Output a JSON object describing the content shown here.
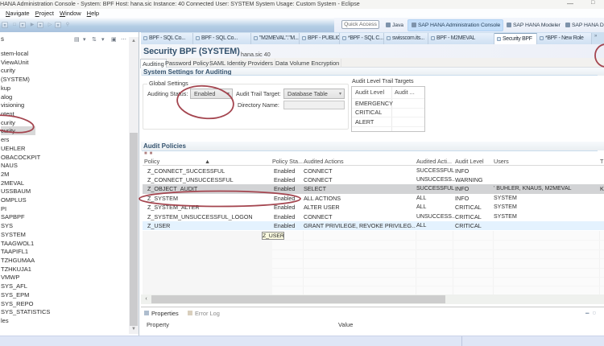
{
  "window": {
    "title": "HANA Administration Console - System: BPF Host: hana.sic Instance: 40 Connected User: SYSTEM System Usage: Custom System - Eclipse",
    "menus": [
      "Navigate",
      "Project",
      "Window",
      "Help"
    ],
    "quick_access_label": "Quick Access",
    "perspectives": [
      {
        "label": "Java"
      },
      {
        "label": "SAP HANA Administration Console",
        "active": true
      },
      {
        "label": "SAP HANA Modeler"
      },
      {
        "label": "SAP HANA Devel"
      }
    ]
  },
  "editor_tabs": [
    {
      "label": "BPF - SQL Co..."
    },
    {
      "label": "BPF - SQL Co..."
    },
    {
      "label": "\"M2MEVAL\".\"M..."
    },
    {
      "label": "BPF - PUBLIC..."
    },
    {
      "label": "*BPF - SQL C..."
    },
    {
      "label": "swisscom.its..."
    },
    {
      "label": "BPF - M2MEVAL"
    },
    {
      "label": "Security BPF",
      "active": true
    },
    {
      "label": "*BPF - New Role"
    }
  ],
  "sidebar": {
    "panel_label": "s",
    "items": [
      {
        "label": "stem-local"
      },
      {
        "label": "ViewAUnit"
      },
      {
        "label": "curity"
      },
      {
        "label": "(SYSTEM)"
      },
      {
        "label": "kup"
      },
      {
        "label": "alog"
      },
      {
        "label": "visioning"
      },
      {
        "label": "ntent"
      },
      {
        "label": "curity"
      },
      {
        "label": "curity",
        "selected": true
      },
      {
        "label": "ers"
      },
      {
        "label": "UEHLER"
      },
      {
        "label": "OBACOCKPIT"
      },
      {
        "label": "NAUS"
      },
      {
        "label": "2M"
      },
      {
        "label": "2MEVAL"
      },
      {
        "label": "USSBAUM"
      },
      {
        "label": "OMPLUS"
      },
      {
        "label": "PI"
      },
      {
        "label": "SAPBPF"
      },
      {
        "label": "SYS"
      },
      {
        "label": "SYSTEM"
      },
      {
        "label": "TAAGWOL1"
      },
      {
        "label": "TAAPIFL1"
      },
      {
        "label": "TZHGUMAA"
      },
      {
        "label": "TZHKUJA1"
      },
      {
        "label": "VMWP"
      },
      {
        "label": "SYS_AFL"
      },
      {
        "label": "SYS_EPM"
      },
      {
        "label": "SYS_REPO"
      },
      {
        "label": "SYS_STATISTICS"
      },
      {
        "label": "les"
      }
    ]
  },
  "editor": {
    "title": "Security BPF (SYSTEM)",
    "subtitle": "hana.sic 40",
    "tabs": [
      {
        "label": "Auditing",
        "active": true
      },
      {
        "label": "Password Policy"
      },
      {
        "label": "SAML Identity Providers"
      },
      {
        "label": "Data Volume Encryption"
      }
    ],
    "settings": {
      "section_title": "System Settings for Auditing",
      "group_label": "Global Settings",
      "auditing_status_label": "Auditing Status:",
      "auditing_status_value": "Enabled",
      "audit_trail_target_label": "Audit Trail Target:",
      "audit_trail_target_value": "Database Table",
      "directory_name_label": "Directory Name:",
      "directory_name_value": "",
      "trail_targets": {
        "label": "Audit Level Trail Targets",
        "columns": [
          "Audit Level",
          "Audit ..."
        ],
        "rows": [
          "EMERGENCY",
          "CRITICAL",
          "ALERT"
        ]
      }
    },
    "policies": {
      "section_title": "Audit Policies",
      "columns": [
        "Policy",
        "Policy Sta...",
        "Audited Actions",
        "Audited Acti...",
        "Audit Level",
        "Users",
        "T"
      ],
      "rows": [
        {
          "policy": "Z_CONNECT_SUCCESSFUL",
          "status": "Enabled",
          "actions": "CONNECT",
          "astatus": "SUCCESSFUL",
          "level": "INFO",
          "users": "",
          "extra": ""
        },
        {
          "policy": "Z_CONNECT_UNSUCCESSFUL",
          "status": "Enabled",
          "actions": "CONNECT",
          "astatus": "UNSUCCESS...",
          "level": "WARNING",
          "users": "",
          "extra": ""
        },
        {
          "policy": "Z_OBJECT_AUDIT",
          "status": "Enabled",
          "actions": "SELECT",
          "astatus": "SUCCESSFUL",
          "level": "INFO",
          "users": "BUHLER, KNAUS, M2MEVAL",
          "extra": "K",
          "selected": true
        },
        {
          "policy": "Z_SYSTEM",
          "status": "Enabled",
          "actions": "ALL ACTIONS",
          "astatus": "ALL",
          "level": "INFO",
          "users": "SYSTEM",
          "extra": ""
        },
        {
          "policy": "Z_SYSTEM_ALTER",
          "status": "Enabled",
          "actions": "ALTER USER",
          "astatus": "ALL",
          "level": "CRITICAL",
          "users": "SYSTEM",
          "extra": ""
        },
        {
          "policy": "Z_SYSTEM_UNSUCCESSFUL_LOGON",
          "status": "Enabled",
          "actions": "CONNECT",
          "astatus": "UNSUCCESS...",
          "level": "CRITICAL",
          "users": "SYSTEM",
          "extra": ""
        },
        {
          "policy": "Z_USER",
          "status": "Enabled",
          "actions": "GRANT PRIVILEGE, REVOKE PRIVILEG...",
          "astatus": "ALL",
          "level": "CRITICAL",
          "users": "",
          "extra": "",
          "highlighted": true
        }
      ],
      "tooltip": "Z_USER"
    }
  },
  "bottom_panel": {
    "tabs": [
      {
        "label": "Properties",
        "active": true
      },
      {
        "label": "Error Log"
      }
    ],
    "columns": [
      "Property",
      "Value"
    ]
  },
  "annotation_color": "#a4454f"
}
